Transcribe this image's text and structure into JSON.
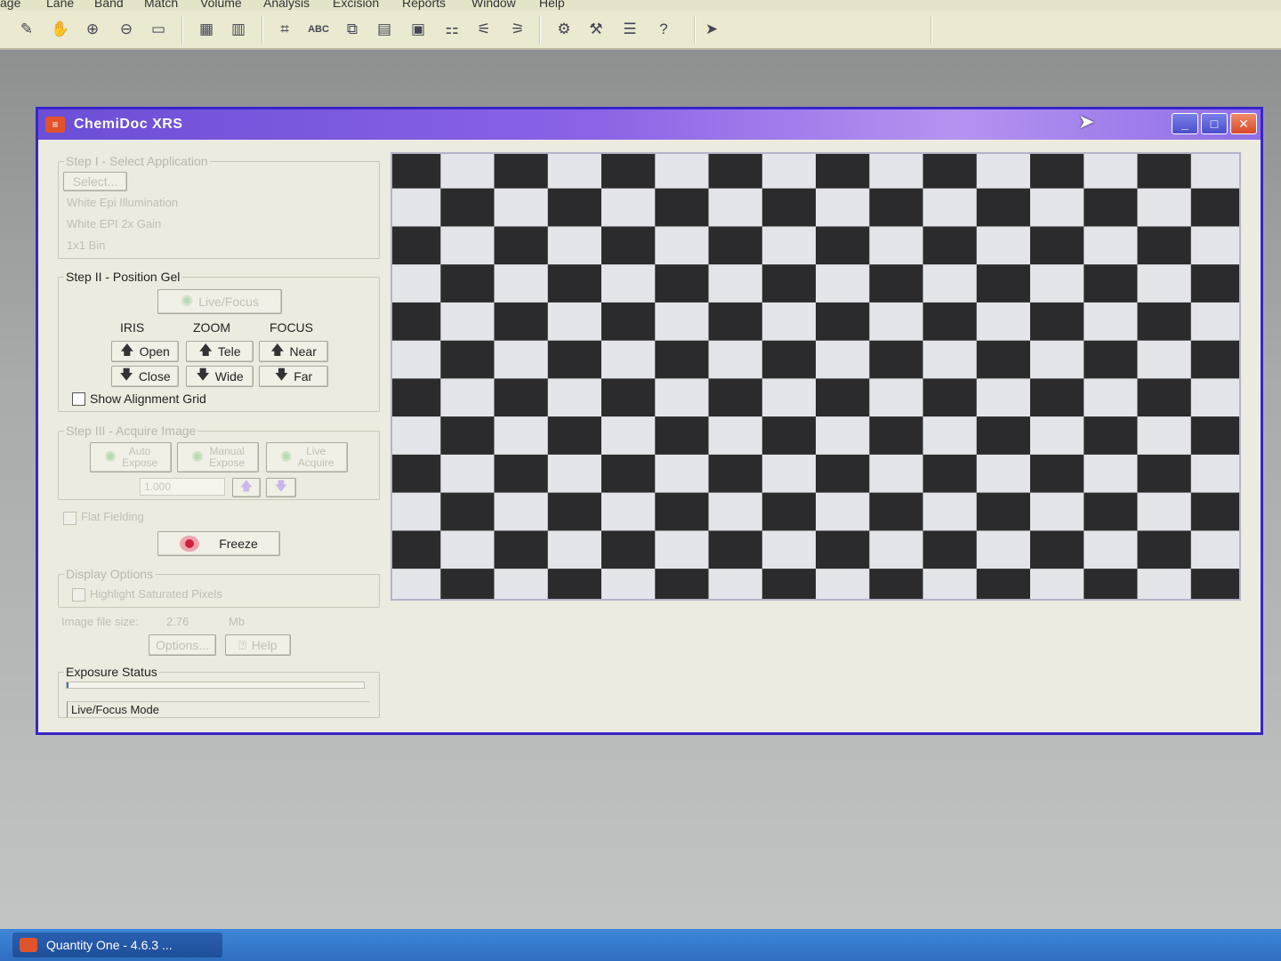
{
  "menu": [
    "age",
    "Lane",
    "Band",
    "Match",
    "Volume",
    "Analysis",
    "Excision",
    "Reports",
    "Window",
    "Help"
  ],
  "toolbar": {
    "abc_label": "ABC"
  },
  "window": {
    "title": "ChemiDoc XRS",
    "minimize_label": "_",
    "maximize_label": "□",
    "close_label": "✕"
  },
  "step1": {
    "legend": "Step I - Select Application",
    "select_button": "Select...",
    "lines": [
      "White Epi Illumination",
      "White EPI 2x Gain",
      "1x1 Bin"
    ]
  },
  "step2": {
    "legend": "Step II - Position Gel",
    "live_focus": "Live/Focus",
    "iris_header": "IRIS",
    "zoom_header": "ZOOM",
    "focus_header": "FOCUS",
    "open": "Open",
    "close": "Close",
    "tele": "Tele",
    "wide": "Wide",
    "near": "Near",
    "far": "Far",
    "show_grid": "Show Alignment Grid"
  },
  "step3": {
    "legend": "Step III - Acquire Image",
    "auto_expose": [
      "Auto",
      "Expose"
    ],
    "manual_expose": [
      "Manual",
      "Expose"
    ],
    "live_acquire": [
      "Live",
      "Acquire"
    ],
    "exposure_value": "1.000"
  },
  "flat_fielding": "Flat Fielding",
  "freeze": "Freeze",
  "display_options": {
    "legend": "Display Options",
    "highlight": "Highlight Saturated Pixels"
  },
  "file_size": {
    "label": "Image file size:",
    "value": "2.76",
    "unit": "Mb"
  },
  "options_button": "Options...",
  "help_button": "Help",
  "exposure_status": {
    "legend": "Exposure Status",
    "progress": 0.005,
    "mode": "Live/Focus Mode"
  },
  "taskbar": {
    "item": "Quantity One - 4.6.3 ..."
  },
  "colors": {
    "title_bar": "#7a58de",
    "window_border": "#3a24c8",
    "taskbar": "#3f86d8"
  }
}
